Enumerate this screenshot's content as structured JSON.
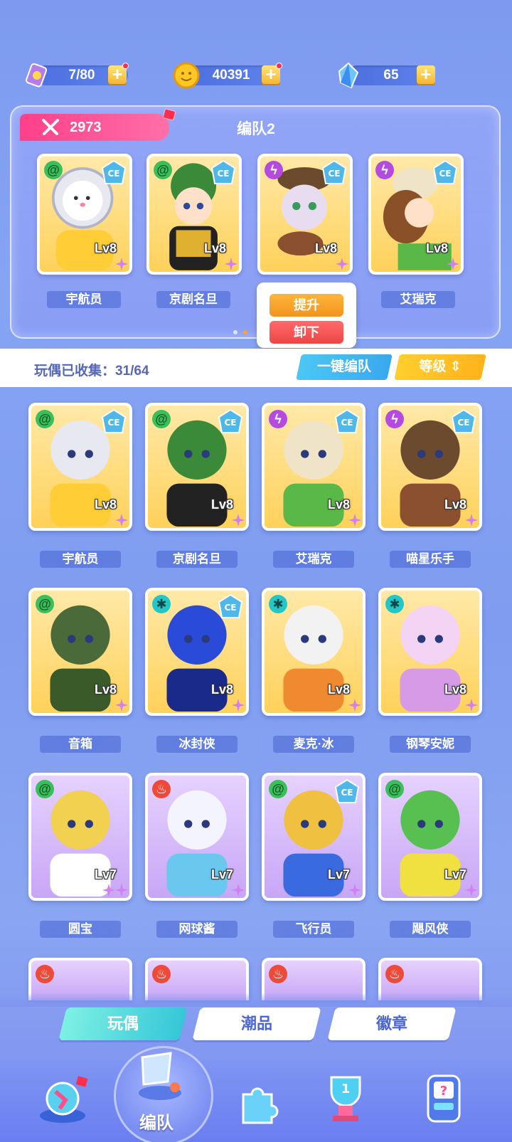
{
  "resources": [
    {
      "icon": "ticket-icon",
      "value": "7/80"
    },
    {
      "icon": "coin-icon",
      "value": "40391"
    },
    {
      "icon": "crystal-icon",
      "value": "65"
    }
  ],
  "team": {
    "score": "2973",
    "title": "编队2",
    "members": [
      {
        "name": "宇航员",
        "level": "Lv8"
      },
      {
        "name": "京剧名旦",
        "level": "Lv8"
      },
      {
        "name": "",
        "level": "Lv8"
      },
      {
        "name": "艾瑞克",
        "level": "Lv8"
      }
    ],
    "popup": {
      "upgrade": "提升",
      "unload": "卸下"
    }
  },
  "collection": {
    "label": "玩偶已收集：31/64",
    "one_key": "一键编队",
    "sort": "等级"
  },
  "grid": [
    {
      "name": "宇航员",
      "level": "Lv8"
    },
    {
      "name": "京剧名旦",
      "level": "Lv8"
    },
    {
      "name": "艾瑞克",
      "level": "Lv8"
    },
    {
      "name": "喵星乐手",
      "level": "Lv8"
    },
    {
      "name": "音箱",
      "level": "Lv8"
    },
    {
      "name": "冰封侠",
      "level": "Lv8"
    },
    {
      "name": "麦克·冰",
      "level": "Lv8"
    },
    {
      "name": "钢琴安妮",
      "level": "Lv8"
    },
    {
      "name": "圆宝",
      "level": "Lv7"
    },
    {
      "name": "网球酱",
      "level": "Lv7"
    },
    {
      "name": "飞行员",
      "level": "Lv7"
    },
    {
      "name": "飓风侠",
      "level": "Lv7"
    }
  ],
  "tabs": [
    "玩偶",
    "潮品",
    "徽章"
  ],
  "nav": {
    "active_label": "编队"
  },
  "colors": {
    "accent_pink": "#ff4f95",
    "accent_orange": "#f29320",
    "accent_cyan": "#35c6d8"
  }
}
